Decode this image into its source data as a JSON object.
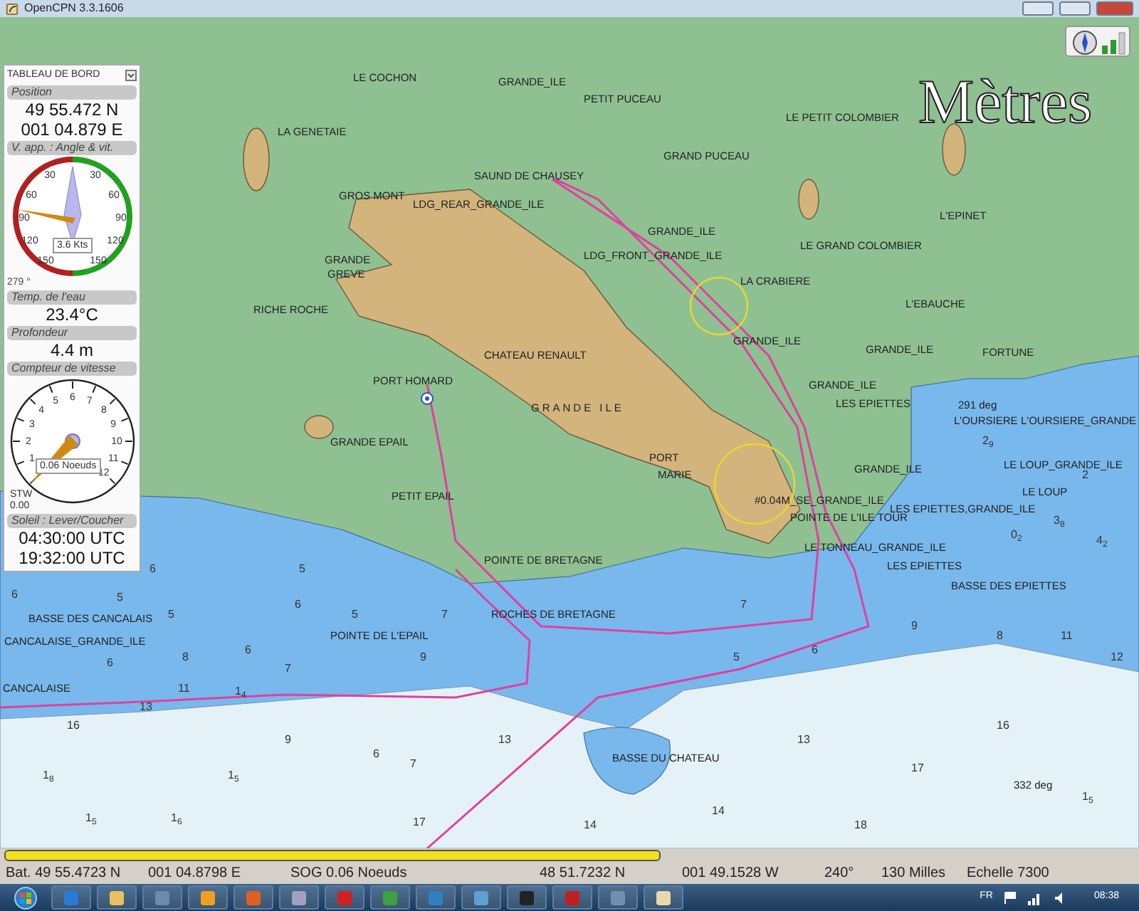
{
  "window": {
    "title": "OpenCPN 3.3.1606"
  },
  "dashboard": {
    "title": "TABLEAU DE BORD",
    "sections": [
      {
        "kind": "text",
        "label": "Position",
        "lines": [
          "49 55.472 N",
          "001 04.879 E"
        ]
      },
      {
        "kind": "wind",
        "label": "V. app. : Angle & vit.",
        "scale": [
          "30",
          "60",
          "90",
          "120",
          "150",
          "30",
          "60",
          "90",
          "120",
          "150"
        ],
        "reading": "3.6 Kts",
        "angle": "279 °"
      },
      {
        "kind": "text",
        "label": "Temp. de l'eau",
        "lines": [
          "23.4°C"
        ]
      },
      {
        "kind": "text",
        "label": "Profondeur",
        "lines": [
          "4.4 m"
        ]
      },
      {
        "kind": "speed",
        "label": "Compteur de vitesse",
        "scale": [
          "1",
          "2",
          "3",
          "4",
          "5",
          "6",
          "7",
          "8",
          "9",
          "10",
          "11",
          "12"
        ],
        "reading": "0.06 Noeuds",
        "stw_label": "STW",
        "stw_value": "0.00"
      },
      {
        "kind": "text",
        "label": "Soleil : Lever/Coucher",
        "lines": [
          "04:30:00 UTC",
          "19:32:00 UTC"
        ]
      }
    ]
  },
  "chart": {
    "units_label": "Mètres",
    "labels": [
      "LE COCHON",
      "GRANDE_ILE",
      "PETIT PUCEAU",
      "LA GENETAIE",
      "LE PETIT COLOMBIER",
      "GRAND PUCEAU",
      "SAUND DE CHAUSEY",
      "GROS MONT",
      "LDG_REAR_GRANDE_ILE",
      "L'EPINET",
      "GRANDE_ILE",
      "LE GRAND COLOMBIER",
      "GRANDE",
      "GREVE",
      "LDG_FRONT_GRANDE_ILE",
      "LA CRABIERE",
      "GRANDE_ILE",
      "RICHE ROCHE",
      "L'EBAUCHE",
      "GRANDE_ILE",
      "CHATEAU RENAULT",
      "FORTUNE",
      "PORT HOMARD",
      "GRANDE_ILE",
      "GRANDE ILE",
      "LES EPIETTES",
      "291 deg",
      "L'OURSIERE",
      "L'OURSIERE_GRANDE",
      "GRANDE EPAIL",
      "PORT",
      "MARIE",
      "GRANDE_ILE",
      "LE LOUP_GRANDE_ILE",
      "#0.04M_SE_GRANDE_ILE",
      "LES EPIETTES,GRANDE_ILE",
      "LE LOUP",
      "PETIT EPAIL",
      "POINTE DE L'ILE TOUR",
      "LE TONNEAU_GRANDE_ILE",
      "LES EPIETTES",
      "POINTE DE BRETAGNE",
      "BASSE DES EPIETTES",
      "BASSE DES CANCALAIS",
      "ROCHES DE BRETAGNE",
      "POINTE DE L'EPAIL",
      "CANCALAISE_GRANDE_ILE",
      "CANCALAISE",
      "BASSE DU CHATEAU",
      "332 deg"
    ],
    "soundings": [
      "2$_{9}$",
      "2",
      "3$_{8}$",
      "0$_{2}$",
      "4$_{2}$",
      "6",
      "5",
      "6",
      "5",
      "6",
      "7",
      "5",
      "5",
      "7",
      "9",
      "8",
      "11",
      "6",
      "6",
      "8",
      "9",
      "5",
      "12",
      "6",
      "7",
      "11",
      "1$_{4}$",
      "13",
      "16",
      "16",
      "9",
      "13",
      "13",
      "6",
      "7",
      "17",
      "1$_{8}$",
      "1$_{5}$",
      "1$_{5}$",
      "14",
      "1$_{5}$",
      "1$_{6}$",
      "17",
      "14",
      "18"
    ]
  },
  "progress": {
    "level": 0.58
  },
  "status_bar": [
    "Bat. 49 55.4723 N",
    "001 04.8798 E",
    "SOG 0.06 Noeuds",
    "48 51.7232 N",
    "001 49.1528 W",
    "240°",
    "130 Milles",
    "Echelle 7300"
  ],
  "taskbar": {
    "language": "FR",
    "time": "08:38"
  }
}
